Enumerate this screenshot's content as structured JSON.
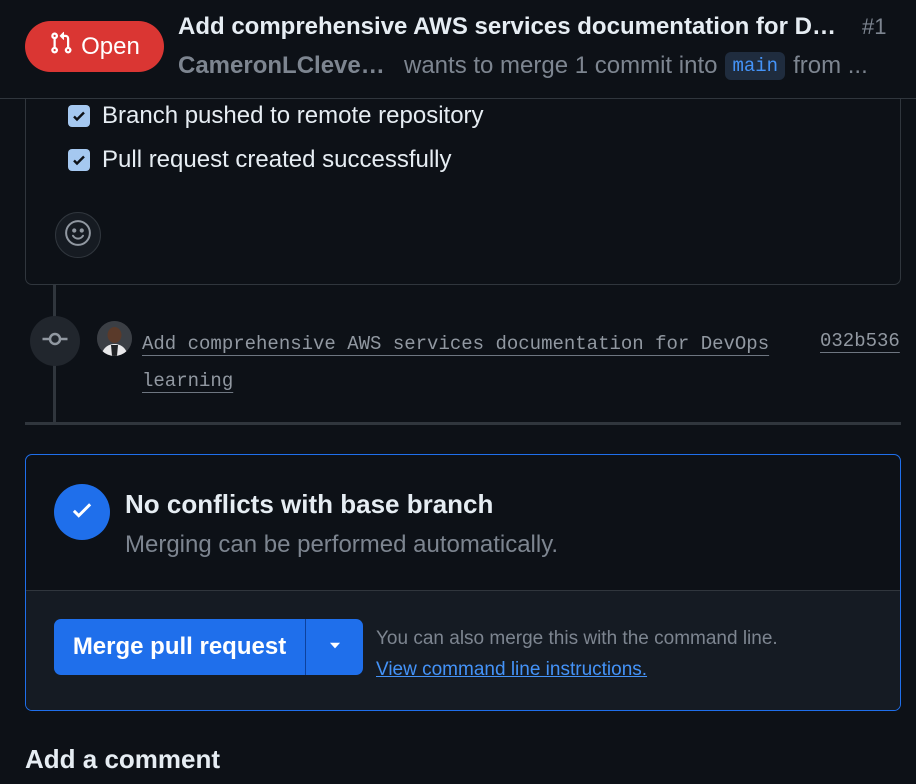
{
  "header": {
    "state_label": "Open",
    "title": "Add comprehensive AWS services documentation for DevOps learning",
    "number": "#1",
    "author": "CameronLClevela...",
    "merge_text": "wants to merge 1 commit into",
    "base_branch": "main",
    "from_text": "from ..."
  },
  "description": {
    "tasks": [
      {
        "label": "Branch pushed to remote repository",
        "checked": true
      },
      {
        "label": "Pull request created successfully",
        "checked": true
      }
    ]
  },
  "commit": {
    "message_line1": "Add comprehensive AWS services documentation for DevOps",
    "message_line2": "learning",
    "sha": "032b536"
  },
  "merge": {
    "heading": "No conflicts with base branch",
    "subtext": "Merging can be performed automatically.",
    "button_label": "Merge pull request",
    "cli_note": "You can also merge this with the command line.",
    "cli_link": "View command line instructions."
  },
  "comment_heading": "Add a comment",
  "colors": {
    "background": "#0d1117",
    "open_badge": "#da3633",
    "accent_blue": "#1f6feb",
    "link_blue": "#4493f8"
  },
  "icons": [
    "git-pull-request-icon",
    "check-icon",
    "smiley-icon",
    "git-commit-icon",
    "chevron-down-icon"
  ]
}
